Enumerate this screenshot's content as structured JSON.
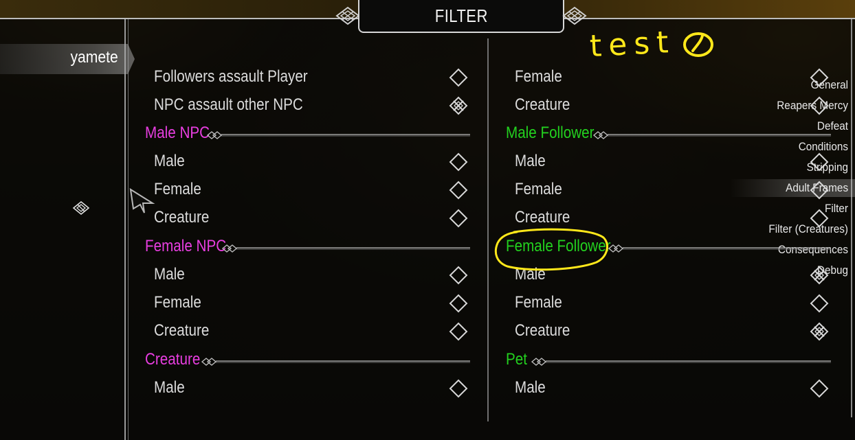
{
  "window": {
    "title": "FILTER"
  },
  "colors": {
    "accent_magenta": "#e83ee0",
    "accent_green": "#23d11f",
    "annotation_yellow": "#ffe81a",
    "text_default": "#dcdcdc"
  },
  "annotation": {
    "text": "test",
    "circle_mark": "①"
  },
  "sidebar": {
    "mod_title": "yamete",
    "items": [
      {
        "label": "General"
      },
      {
        "label": "Reapers Mercy"
      },
      {
        "label": "Defeat"
      },
      {
        "label": "Conditions"
      },
      {
        "label": "Stripping"
      },
      {
        "label": "Adult Frames",
        "selected": true
      },
      {
        "label": "Filter",
        "icon": "filter-knot-icon",
        "current": true
      },
      {
        "label": "Filter (Creatures)"
      },
      {
        "label": "Consequences"
      },
      {
        "label": "Debug"
      }
    ]
  },
  "left_column": {
    "rows": [
      {
        "type": "option",
        "label": "Followers assault Player",
        "checked": false
      },
      {
        "type": "option",
        "label": "NPC assault other NPC",
        "checked": true
      },
      {
        "type": "header",
        "label": "Male NPC",
        "color": "magenta"
      },
      {
        "type": "option",
        "label": "Male",
        "checked": false
      },
      {
        "type": "option",
        "label": "Female",
        "checked": false
      },
      {
        "type": "option",
        "label": "Creature",
        "checked": false
      },
      {
        "type": "header",
        "label": "Female NPC",
        "color": "magenta"
      },
      {
        "type": "option",
        "label": "Male",
        "checked": false
      },
      {
        "type": "option",
        "label": "Female",
        "checked": false
      },
      {
        "type": "option",
        "label": "Creature",
        "checked": false
      },
      {
        "type": "header",
        "label": "Creature",
        "color": "magenta"
      },
      {
        "type": "option",
        "label": "Male",
        "checked": false
      }
    ]
  },
  "right_column": {
    "rows": [
      {
        "type": "option",
        "label": "Female",
        "checked": false
      },
      {
        "type": "option",
        "label": "Creature",
        "checked": false
      },
      {
        "type": "header",
        "label": "Male Follower",
        "color": "green"
      },
      {
        "type": "option",
        "label": "Male",
        "checked": false
      },
      {
        "type": "option",
        "label": "Female",
        "checked": false
      },
      {
        "type": "option",
        "label": "Creature",
        "checked": false
      },
      {
        "type": "header",
        "label": "Female Follower",
        "color": "green",
        "circled": true
      },
      {
        "type": "option",
        "label": "Male",
        "checked": true
      },
      {
        "type": "option",
        "label": "Female",
        "checked": false
      },
      {
        "type": "option",
        "label": "Creature",
        "checked": true
      },
      {
        "type": "header",
        "label": "Pet",
        "color": "green"
      },
      {
        "type": "option",
        "label": "Male",
        "checked": false
      }
    ]
  }
}
